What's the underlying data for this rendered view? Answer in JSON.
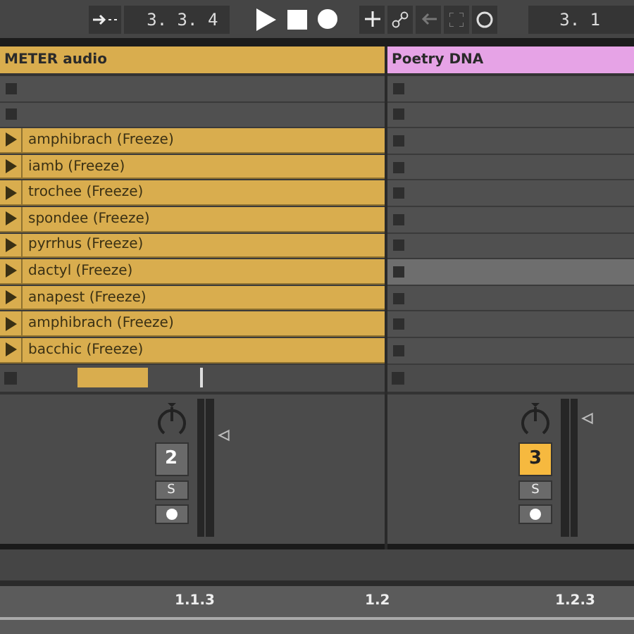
{
  "transport": {
    "position": "3. 3. 4",
    "loop_start": "3. 1"
  },
  "tracks": [
    {
      "name": "METER audio",
      "color": "#d9ad4e",
      "fader": true,
      "slots": [
        {
          "kind": "empty",
          "selected": false
        },
        {
          "kind": "empty",
          "selected": false
        },
        {
          "kind": "clip",
          "name": "amphibrach (Freeze)",
          "selected": false
        },
        {
          "kind": "clip",
          "name": "iamb (Freeze)",
          "selected": false
        },
        {
          "kind": "clip",
          "name": "trochee (Freeze)",
          "selected": false
        },
        {
          "kind": "clip",
          "name": "spondee (Freeze)",
          "selected": false
        },
        {
          "kind": "clip",
          "name": "pyrrhus (Freeze)",
          "selected": false
        },
        {
          "kind": "clip",
          "name": "dactyl (Freeze)",
          "selected": false
        },
        {
          "kind": "clip",
          "name": "anapest (Freeze)",
          "selected": false
        },
        {
          "kind": "clip",
          "name": "amphibrach (Freeze)",
          "selected": false
        },
        {
          "kind": "clip",
          "name": "bacchic (Freeze)",
          "selected": false
        }
      ],
      "activator": {
        "label": "2",
        "on": false
      },
      "solo": "S"
    },
    {
      "name": "Poetry DNA",
      "color": "#e6a3e6",
      "fader": false,
      "slots": [
        {
          "kind": "empty",
          "selected": false
        },
        {
          "kind": "empty",
          "selected": false
        },
        {
          "kind": "empty",
          "selected": false
        },
        {
          "kind": "empty",
          "selected": false
        },
        {
          "kind": "empty",
          "selected": false
        },
        {
          "kind": "empty",
          "selected": false
        },
        {
          "kind": "empty",
          "selected": false
        },
        {
          "kind": "empty",
          "selected": true
        },
        {
          "kind": "empty",
          "selected": false
        },
        {
          "kind": "empty",
          "selected": false
        },
        {
          "kind": "empty",
          "selected": false
        }
      ],
      "activator": {
        "label": "3",
        "on": true
      },
      "solo": "S"
    }
  ],
  "ruler": {
    "labels": [
      "1.1.3",
      "1.2",
      "1.2.3"
    ]
  }
}
